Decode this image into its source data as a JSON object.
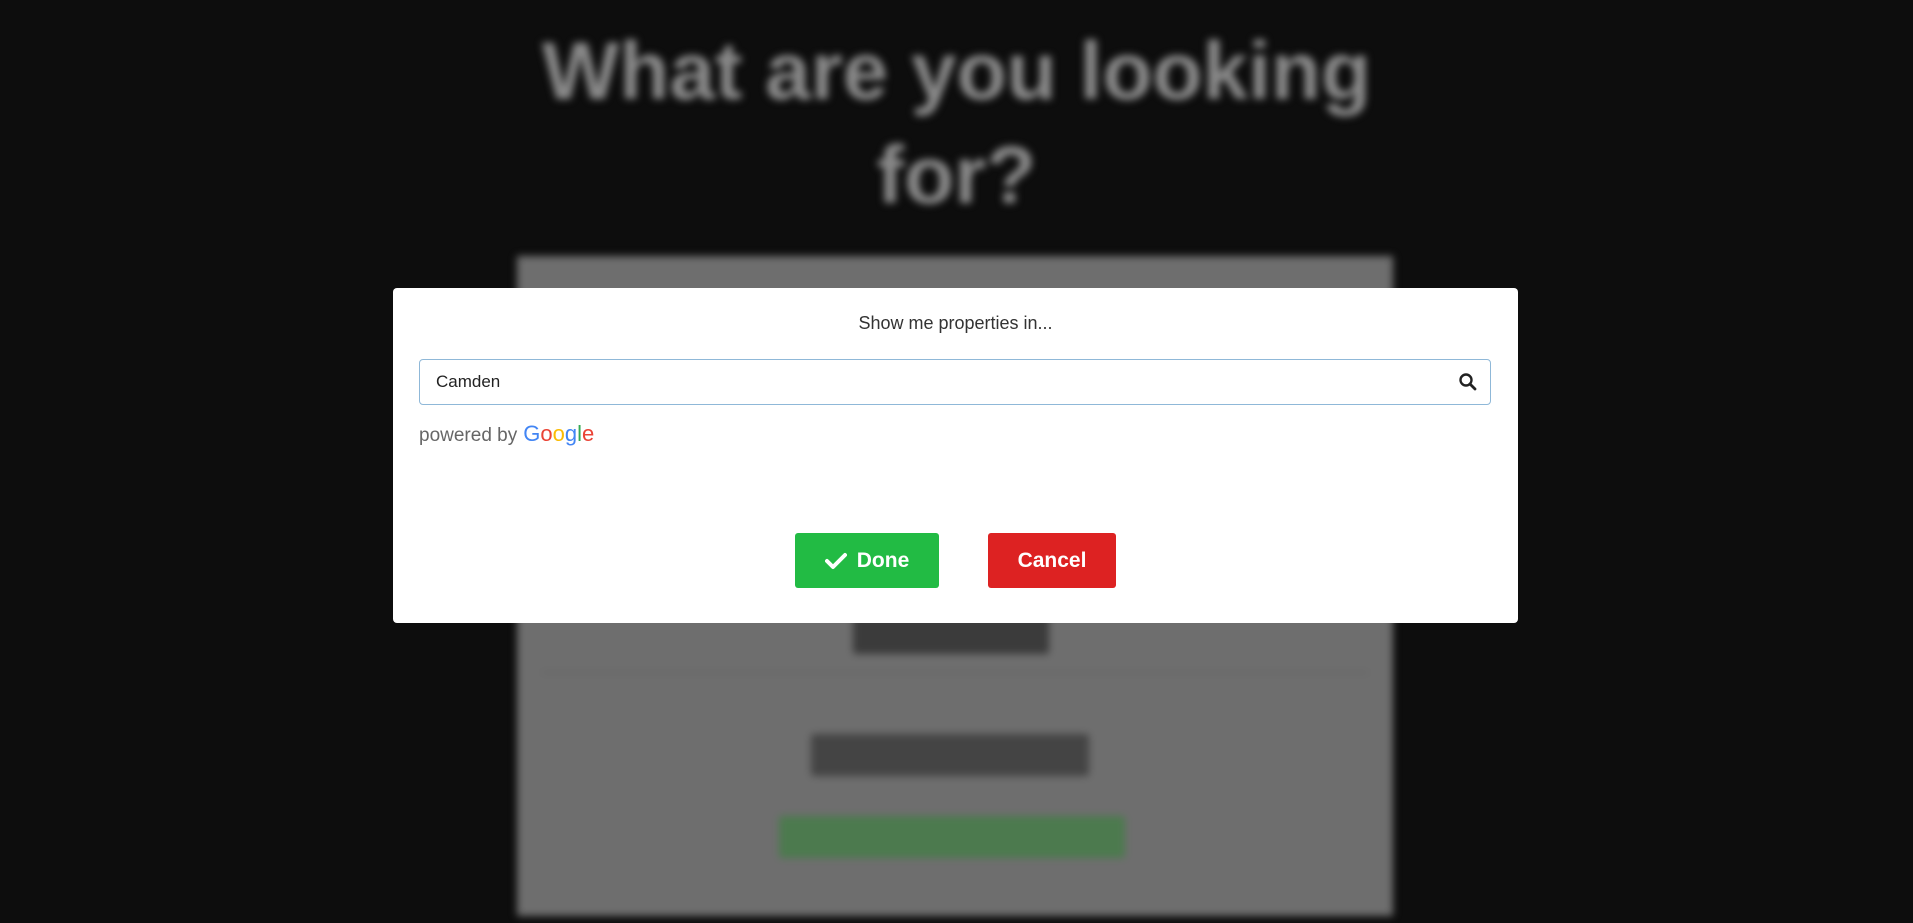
{
  "background": {
    "heading_line1": "What are you looking",
    "heading_line2": "for?"
  },
  "modal": {
    "title": "Show me properties in...",
    "search": {
      "value": "Camden",
      "icon": "search-icon"
    },
    "attribution": {
      "prefix": "powered by",
      "brand_letters": [
        "G",
        "o",
        "o",
        "g",
        "l",
        "e"
      ]
    },
    "buttons": {
      "done_label": "Done",
      "done_icon": "check-icon",
      "cancel_label": "Cancel"
    }
  },
  "colors": {
    "done": "#22bb44",
    "cancel": "#dd2222",
    "input_border": "#8fb8d8"
  }
}
